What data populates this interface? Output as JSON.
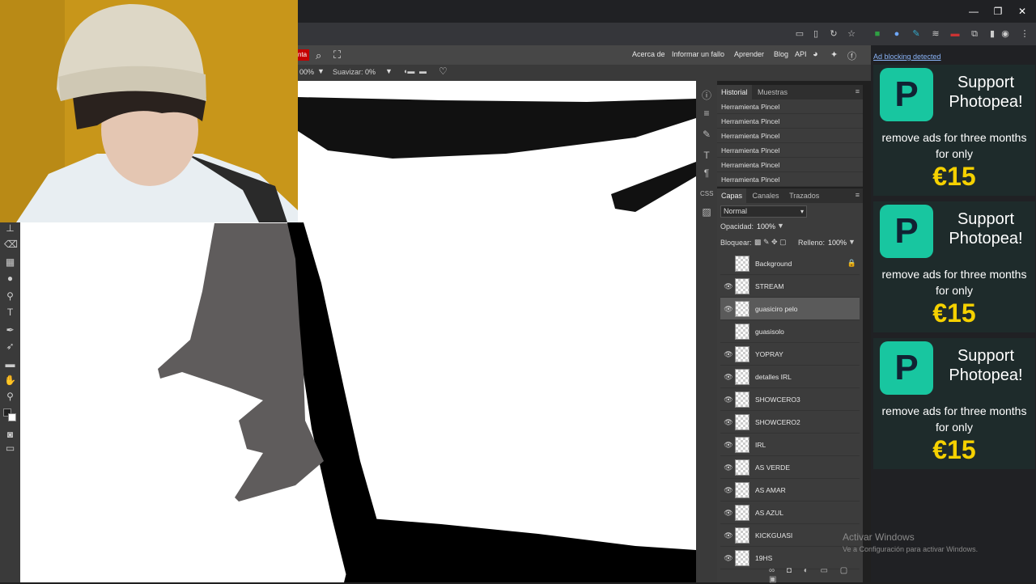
{
  "browser": {
    "window_controls": [
      "—",
      "❐",
      "✕"
    ]
  },
  "menu": {
    "left_button": "nta",
    "links": [
      "Acerca de",
      "Informar un fallo",
      "Aprender",
      "Blog",
      "API"
    ]
  },
  "options": {
    "opacity_value": "00%",
    "smooth_label": "Suavizar:",
    "smooth_value": "0%"
  },
  "history": {
    "tabs": [
      "Historial",
      "Muestras"
    ],
    "items": [
      "Herramienta Pincel",
      "Herramienta Pincel",
      "Herramienta Pincel",
      "Herramienta Pincel",
      "Herramienta Pincel",
      "Herramienta Pincel"
    ]
  },
  "layers": {
    "tabs": [
      "Capas",
      "Canales",
      "Trazados"
    ],
    "blend_mode": "Normal",
    "opacity_label": "Opacidad:",
    "opacity_value": "100%",
    "lock_label": "Bloquear:",
    "fill_label": "Relleno:",
    "fill_value": "100%",
    "items": [
      {
        "name": "Background",
        "visible": false,
        "locked": true
      },
      {
        "name": "STREAM",
        "visible": true
      },
      {
        "name": "guasiciro pelo",
        "visible": true,
        "selected": true
      },
      {
        "name": "guasisolo",
        "visible": false
      },
      {
        "name": "YOPRAY",
        "visible": true
      },
      {
        "name": "detalles IRL",
        "visible": true
      },
      {
        "name": "SHOWCERO3",
        "visible": true
      },
      {
        "name": "SHOWCERO2",
        "visible": true
      },
      {
        "name": "IRL",
        "visible": true
      },
      {
        "name": "AS VERDE",
        "visible": true
      },
      {
        "name": "AS AMAR",
        "visible": true
      },
      {
        "name": "AS AZUL",
        "visible": true
      },
      {
        "name": "KICKGUASI",
        "visible": true
      },
      {
        "name": "19HS",
        "visible": true
      }
    ]
  },
  "ads": {
    "header": "Ad blocking detected",
    "support": "Support Photopea!",
    "remove": "remove ads for three months for only",
    "price": "€15"
  },
  "watermark": {
    "title": "Activar Windows",
    "subtitle": "Ve a Configuración para activar Windows."
  }
}
